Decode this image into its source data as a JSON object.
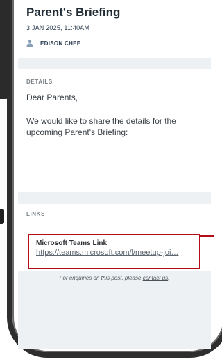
{
  "post": {
    "title": "Parent's Briefing",
    "date": "3 JAN 2025, 11:40AM",
    "author": "EDISON CHEE"
  },
  "details": {
    "label": "DETAILS",
    "greeting": "Dear Parents,",
    "body": "We would like to share the details for the upcoming Parent's Briefing:"
  },
  "links": {
    "label": "LINKS",
    "items": [
      {
        "title": "Microsoft Teams Link",
        "url": "https://teams.microsoft.com/l/meetup-joi…"
      }
    ]
  },
  "footer": {
    "enquiry_prefix": "For enquiries on this post, please ",
    "contact_label": "contact us",
    "enquiry_suffix": "."
  },
  "colors": {
    "highlight": "#b30d1a",
    "band": "#eef1f3",
    "frame": "#2e2e2e"
  },
  "icons": {
    "author": "person-icon"
  }
}
